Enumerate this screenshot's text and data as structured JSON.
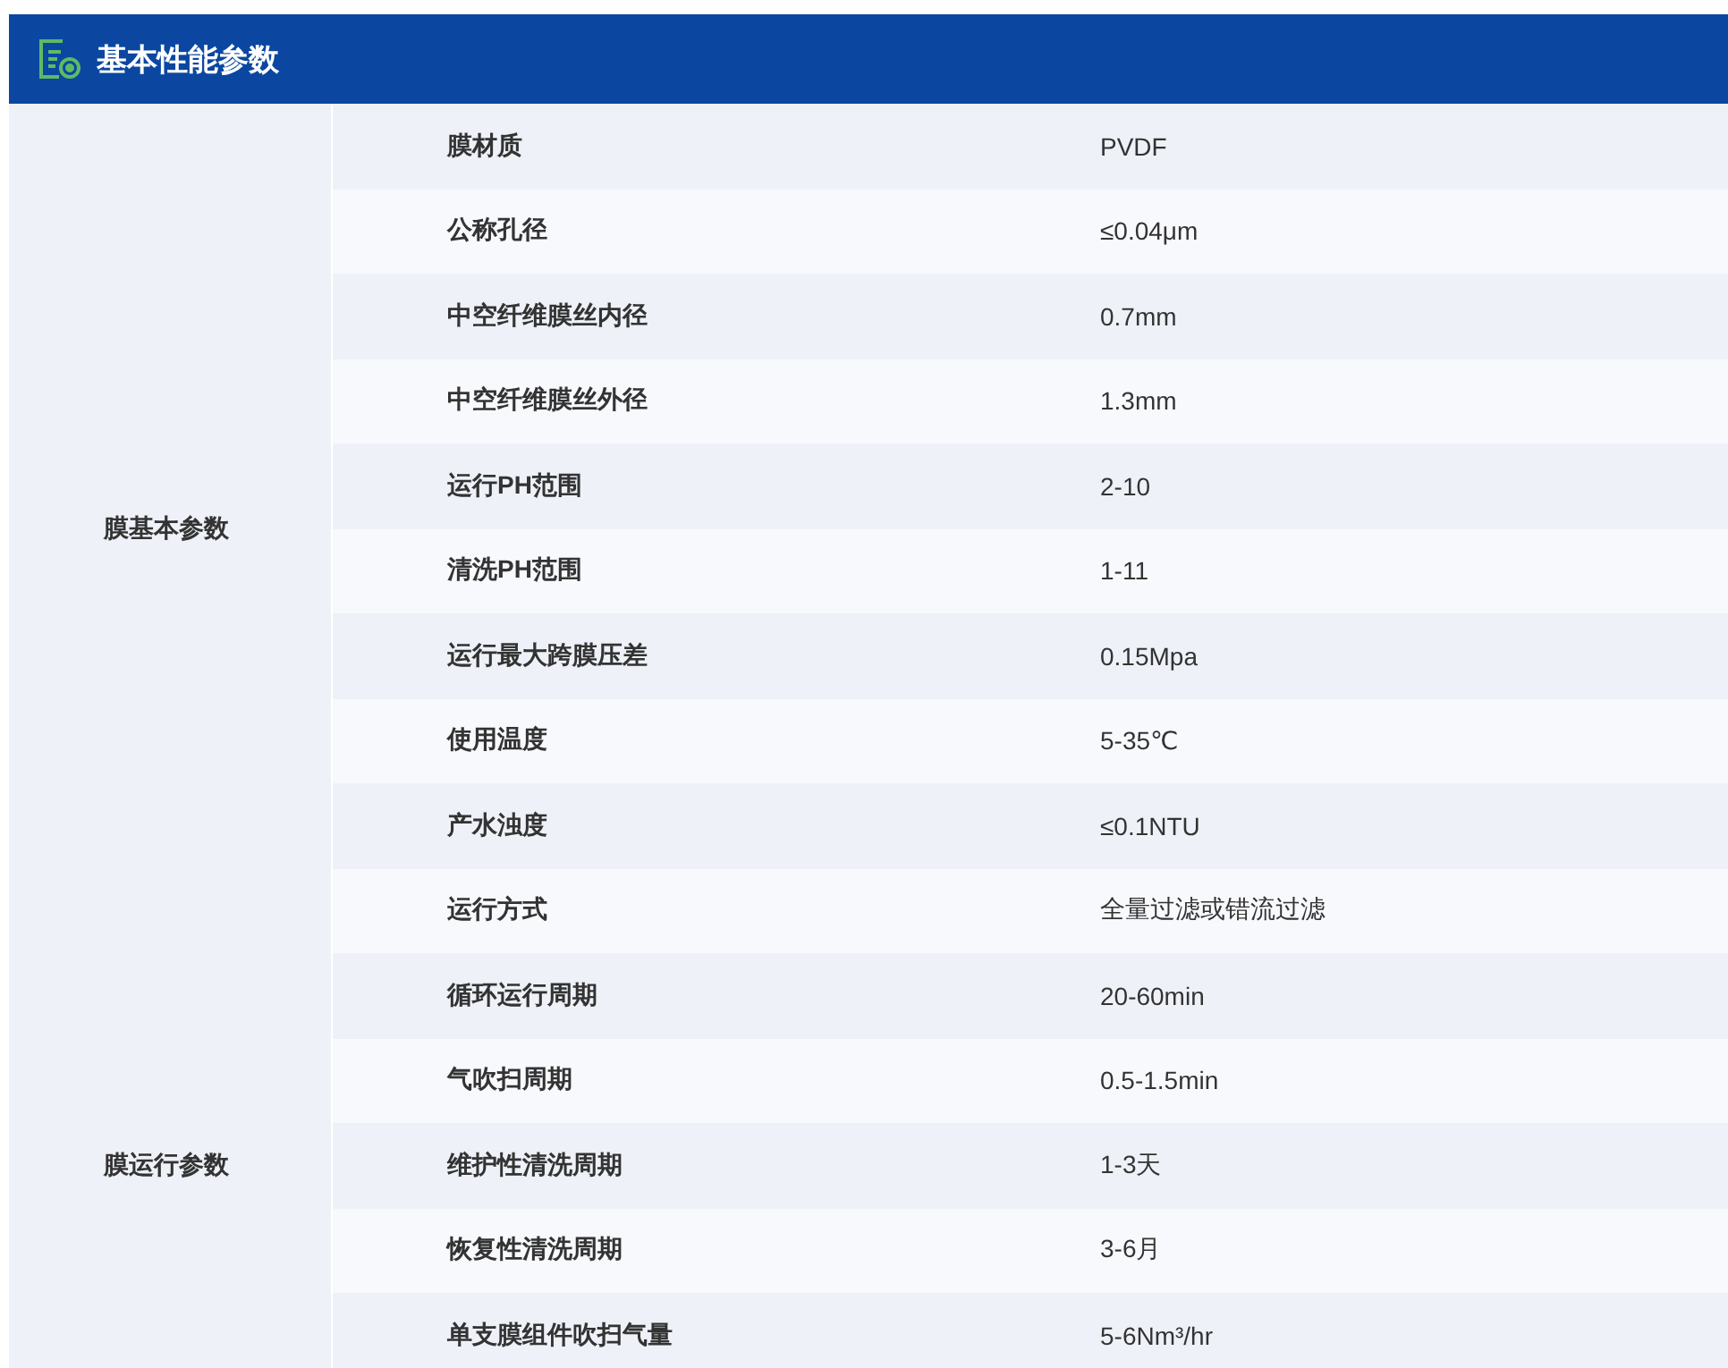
{
  "header": {
    "title": "基本性能参数"
  },
  "groups": [
    {
      "name": "膜基本参数",
      "rows": [
        {
          "label": "膜材质",
          "value": "PVDF"
        },
        {
          "label": "公称孔径",
          "value": "≤0.04μm"
        },
        {
          "label": "中空纤维膜丝内径",
          "value": "0.7mm"
        },
        {
          "label": "中空纤维膜丝外径",
          "value": "1.3mm"
        },
        {
          "label": "运行PH范围",
          "value": "2-10"
        },
        {
          "label": "清洗PH范围",
          "value": "1-11"
        },
        {
          "label": "运行最大跨膜压差",
          "value": "0.15Mpa"
        },
        {
          "label": "使用温度",
          "value": "5-35℃"
        },
        {
          "label": "产水浊度",
          "value": "≤0.1NTU"
        },
        {
          "label": "运行方式",
          "value": "全量过滤或错流过滤"
        }
      ]
    },
    {
      "name": "膜运行参数",
      "rows": [
        {
          "label": "循环运行周期",
          "value": "20-60min"
        },
        {
          "label": "气吹扫周期",
          "value": "0.5-1.5min"
        },
        {
          "label": "维护性清洗周期",
          "value": "1-3天"
        },
        {
          "label": "恢复性清洗周期",
          "value": "3-6月"
        },
        {
          "label": "单支膜组件吹扫气量",
          "value": "5-6Nm³/hr"
        }
      ]
    }
  ]
}
